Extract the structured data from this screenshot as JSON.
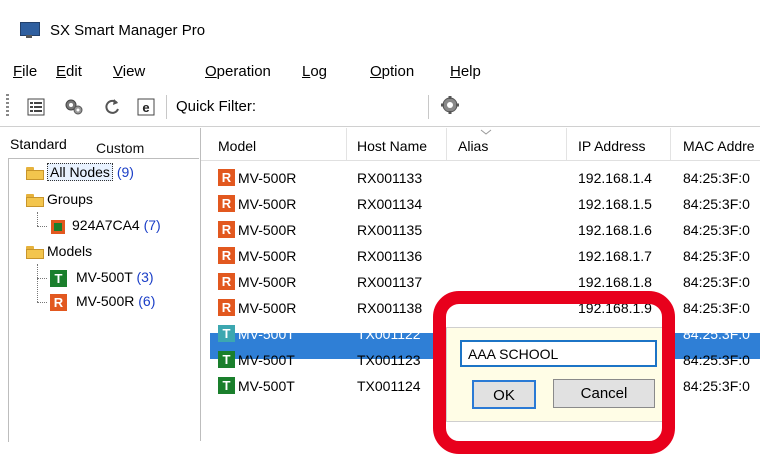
{
  "window": {
    "title": "SX Smart Manager Pro"
  },
  "menu": [
    {
      "key": "F",
      "rest": "ile"
    },
    {
      "key": "E",
      "rest": "dit"
    },
    {
      "key": "V",
      "rest": "iew"
    },
    {
      "key": "O",
      "rest": "peration"
    },
    {
      "key": "L",
      "rest": "og"
    },
    {
      "key": "O",
      "rest": "ption"
    },
    {
      "key": "H",
      "rest": "elp"
    }
  ],
  "toolbar": {
    "quick_filter_label": "Quick Filter:",
    "quick_filter_value": "",
    "info_icon_text": "e"
  },
  "tabs": {
    "standard": "Standard",
    "custom": "Custom"
  },
  "tree": {
    "all_nodes": {
      "label": "All Nodes",
      "count": "(9)"
    },
    "groups": {
      "label": "Groups"
    },
    "group_item": {
      "label": "924A7CA4",
      "count": "(7)"
    },
    "models": {
      "label": "Models"
    },
    "model_t": {
      "label": "MV-500T",
      "count": "(3)"
    },
    "model_r": {
      "label": "MV-500R",
      "count": "(6)"
    }
  },
  "columns": [
    "Model",
    "Host Name",
    "Alias",
    "IP Address",
    "MAC Addre"
  ],
  "rows": [
    {
      "type": "R",
      "model": "MV-500R",
      "host": "RX001133",
      "alias": "",
      "ip": "192.168.1.4",
      "mac": "84:25:3F:0"
    },
    {
      "type": "R",
      "model": "MV-500R",
      "host": "RX001134",
      "alias": "",
      "ip": "192.168.1.5",
      "mac": "84:25:3F:0"
    },
    {
      "type": "R",
      "model": "MV-500R",
      "host": "RX001135",
      "alias": "",
      "ip": "192.168.1.6",
      "mac": "84:25:3F:0"
    },
    {
      "type": "R",
      "model": "MV-500R",
      "host": "RX001136",
      "alias": "",
      "ip": "192.168.1.7",
      "mac": "84:25:3F:0"
    },
    {
      "type": "R",
      "model": "MV-500R",
      "host": "RX001137",
      "alias": "",
      "ip": "192.168.1.8",
      "mac": "84:25:3F:0"
    },
    {
      "type": "R",
      "model": "MV-500R",
      "host": "RX001138",
      "alias": "",
      "ip": "192.168.1.9",
      "mac": "84:25:3F:0"
    },
    {
      "type": "T",
      "model": "MV-500T",
      "host": "TX001122",
      "alias": "",
      "ip": "",
      "mac": "84:25:3F:0"
    },
    {
      "type": "T",
      "model": "MV-500T",
      "host": "TX001123",
      "alias": "",
      "ip": "",
      "mac": "84:25:3F:0"
    },
    {
      "type": "T",
      "model": "MV-500T",
      "host": "TX001124",
      "alias": "",
      "ip": "",
      "mac": "84:25:3F:0"
    }
  ],
  "alias_editor": {
    "value": "AAA SCHOOL",
    "ok_label": "OK",
    "cancel_label": "Cancel"
  },
  "colors": {
    "selection": "#2f7fd6",
    "highlight_ring": "#e8001c",
    "badge_r": "#e2581f",
    "badge_t": "#1a7f2c",
    "count_text": "#1a3ec7"
  }
}
